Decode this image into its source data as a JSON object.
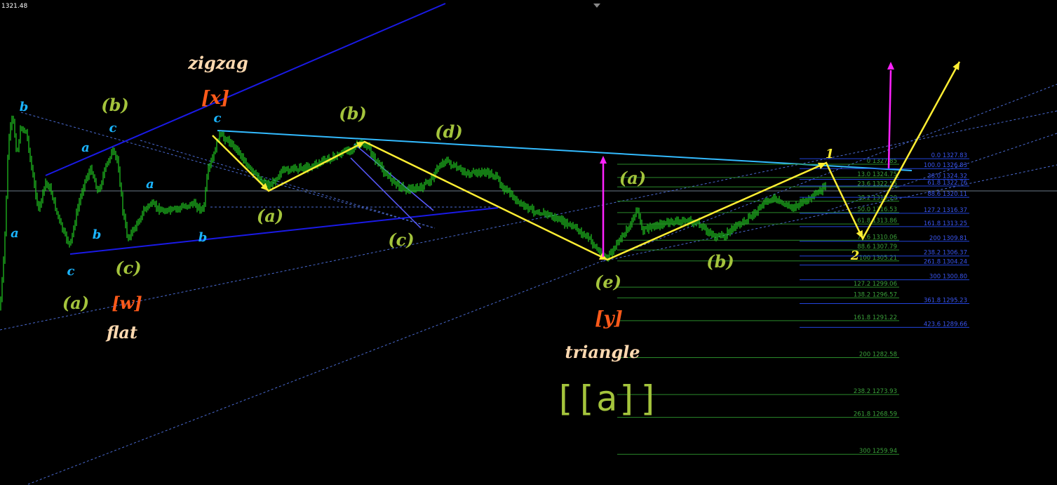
{
  "price_readout": "1321.48",
  "chart_data": {
    "type": "line",
    "title": "",
    "price_scale": {
      "top": 1321.48,
      "min": 1259.94,
      "max": 1327.83
    },
    "grid": false,
    "colors": {
      "background": "#000000",
      "candles": "#22cc22",
      "wave_path": "#ffee33",
      "label_green": "#a4c43c",
      "label_blue": "#1ab4ff",
      "label_orange": "#ff5a1a",
      "label_cream": "#ffd9b0",
      "channel": "#1a1ae6",
      "trendline": "#33bbff",
      "target_arrow": "#ff22ff",
      "fib_green": "#2a8a2a",
      "fib_blue": "#2244dd"
    },
    "wave_labels": {
      "blue": [
        {
          "text": "a",
          "id": "b1"
        },
        {
          "text": "b",
          "id": "b2"
        },
        {
          "text": "c",
          "id": "b3"
        },
        {
          "text": "a",
          "id": "b4"
        },
        {
          "text": "b",
          "id": "b5"
        },
        {
          "text": "c",
          "id": "b6"
        },
        {
          "text": "a",
          "id": "b7"
        },
        {
          "text": "b",
          "id": "b8"
        },
        {
          "text": "c",
          "id": "b9"
        }
      ],
      "green": [
        {
          "text": "(a)",
          "id": "g1"
        },
        {
          "text": "(b)",
          "id": "g2"
        },
        {
          "text": "(c)",
          "id": "g3"
        },
        {
          "text": "(a)",
          "id": "g4"
        },
        {
          "text": "(b)",
          "id": "g5"
        },
        {
          "text": "(c)",
          "id": "g6"
        },
        {
          "text": "(d)",
          "id": "g7"
        },
        {
          "text": "(e)",
          "id": "g8"
        },
        {
          "text": "(a)",
          "id": "g9"
        },
        {
          "text": "(b)",
          "id": "g10"
        }
      ],
      "orange": [
        {
          "text": "[w]",
          "id": "o1"
        },
        {
          "text": "[x]",
          "id": "o2"
        },
        {
          "text": "[y]",
          "id": "o3"
        }
      ],
      "cream": [
        {
          "text": "flat",
          "id": "c1"
        },
        {
          "text": "zigzag",
          "id": "c2"
        },
        {
          "text": "triangle",
          "id": "c3"
        }
      ],
      "yellow": [
        {
          "text": "1",
          "id": "y1"
        },
        {
          "text": "2",
          "id": "y2"
        }
      ],
      "degree": "[[a]]"
    },
    "fib_levels_green": [
      {
        "label": "0",
        "value": 1327.85
      },
      {
        "label": "13.0",
        "value": 1324.75
      },
      {
        "label": "23.6",
        "value": 1322.55
      },
      {
        "label": "38.2",
        "value": 1319.2
      },
      {
        "label": "50.0",
        "value": 1316.53
      },
      {
        "label": "61.8",
        "value": 1313.86
      },
      {
        "label": "78.6",
        "value": 1310.06
      },
      {
        "label": "88.6",
        "value": 1307.79
      },
      {
        "label": "100",
        "value": 1305.21
      },
      {
        "label": "127.2",
        "value": 1299.06
      },
      {
        "label": "138.2",
        "value": 1296.57
      },
      {
        "label": "161.8",
        "value": 1291.22
      },
      {
        "label": "200",
        "value": 1282.58
      },
      {
        "label": "238.2",
        "value": 1273.93
      },
      {
        "label": "261.8",
        "value": 1268.59
      },
      {
        "label": "300",
        "value": 1259.94
      }
    ],
    "fib_levels_blue": [
      {
        "label": "0.0",
        "value": 1327.83
      },
      {
        "label": "100.0",
        "value": 1326.83
      },
      {
        "label": "38.0",
        "value": 1324.32
      },
      {
        "label": "61.8",
        "value": 1322.76
      },
      {
        "label": "88.6",
        "value": 1320.11
      },
      {
        "label": "127.2",
        "value": 1316.37
      },
      {
        "label": "161.8",
        "value": 1313.25
      },
      {
        "label": "200",
        "value": 1309.81
      },
      {
        "label": "238.2",
        "value": 1306.37
      },
      {
        "label": "261.8",
        "value": 1304.24
      },
      {
        "label": "300",
        "value": 1300.8
      },
      {
        "label": "361.8",
        "value": 1295.23
      },
      {
        "label": "423.6",
        "value": 1289.66
      }
    ]
  }
}
